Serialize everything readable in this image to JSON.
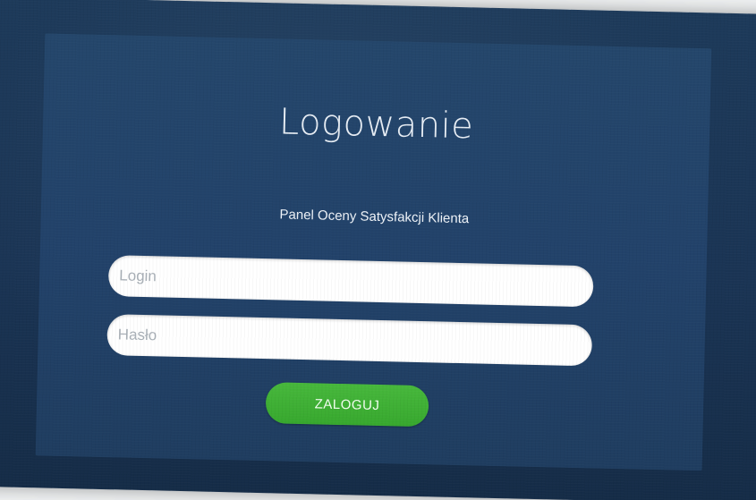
{
  "login_page": {
    "title": "Logowanie",
    "subtitle": "Panel Oceny Satysfakcji Klienta",
    "login_field": {
      "placeholder": "Login",
      "value": ""
    },
    "password_field": {
      "placeholder": "Hasło",
      "value": ""
    },
    "submit_label": "ZALOGUJ"
  },
  "colors": {
    "background": "#1d3a5a",
    "panel": "#22426a",
    "button": "#3cae32",
    "field": "#ffffff"
  }
}
